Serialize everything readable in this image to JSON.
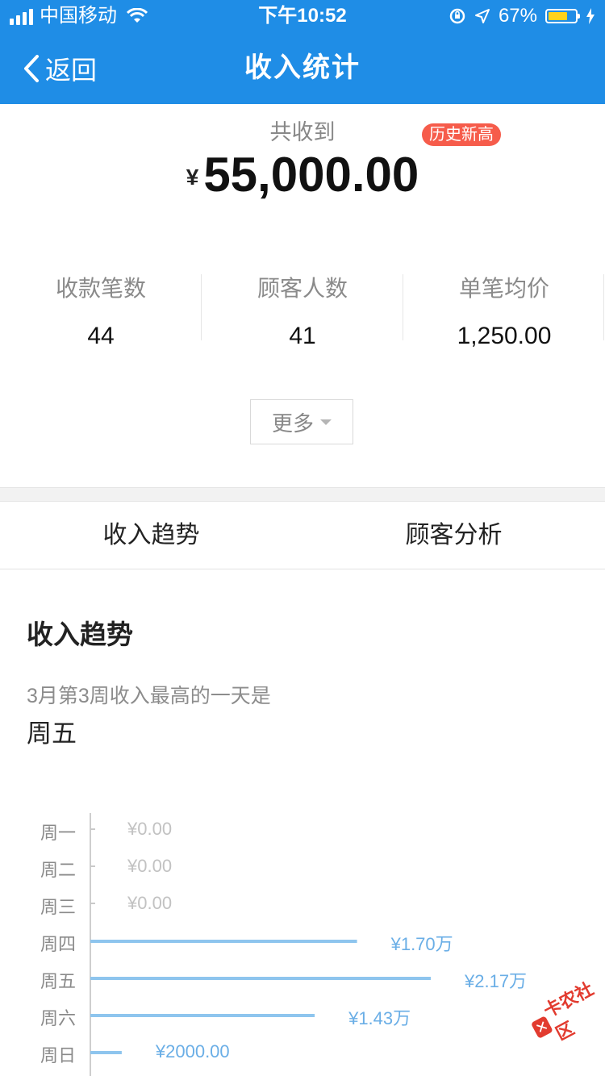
{
  "status_bar": {
    "carrier": "中国移动",
    "time": "下午10:52",
    "battery_percent": "67%",
    "battery_level": 0.67
  },
  "nav": {
    "back_label": "返回",
    "title": "收入统计"
  },
  "summary": {
    "total_label": "共收到",
    "badge": "历史新高",
    "currency_symbol": "¥",
    "total_amount": "55,000.00"
  },
  "stats": [
    {
      "label": "收款笔数",
      "value": "44"
    },
    {
      "label": "顾客人数",
      "value": "41"
    },
    {
      "label": "单笔均价",
      "value": "1,250.00"
    }
  ],
  "more_label": "更多",
  "tabs": [
    {
      "label": "收入趋势"
    },
    {
      "label": "顾客分析"
    }
  ],
  "trend": {
    "title": "收入趋势",
    "subtitle": "3月第3周收入最高的一天是",
    "highlight_day": "周五"
  },
  "colors": {
    "brand": "#1f8de6",
    "bar": "#8ec5ee",
    "bar_label": "#6aaee6",
    "zero_label": "#c2c2c2",
    "badge": "#f65c4b"
  },
  "chart_data": {
    "type": "bar",
    "orientation": "horizontal",
    "categories": [
      "周一",
      "周二",
      "周三",
      "周四",
      "周五",
      "周六",
      "周日"
    ],
    "values": [
      0,
      0,
      0,
      17000,
      21700,
      14300,
      2000
    ],
    "value_labels": [
      "¥0.00",
      "¥0.00",
      "¥0.00",
      "¥1.70万",
      "¥2.17万",
      "¥1.43万",
      "¥2000.00"
    ],
    "xlim": [
      0,
      21700
    ],
    "grid": false,
    "legend": "none"
  },
  "watermark": "卡农社区"
}
